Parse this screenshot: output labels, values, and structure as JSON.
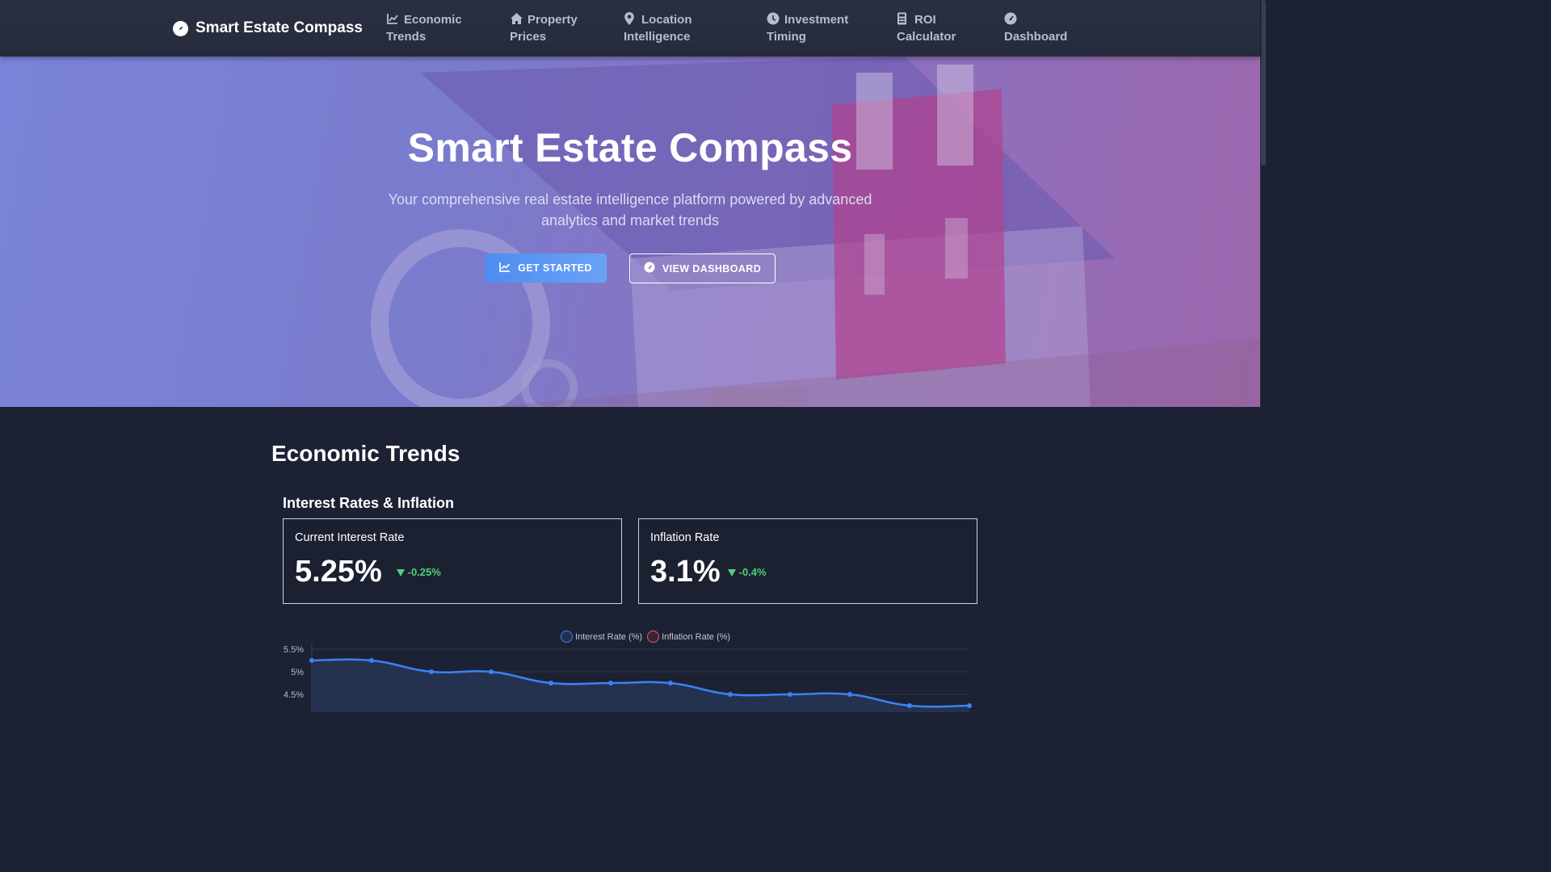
{
  "brand": {
    "name": "Smart Estate Compass",
    "icon": "compass-icon"
  },
  "nav": {
    "items": [
      {
        "line1": "Economic",
        "line2": "Trends",
        "icon": "chart-line-icon"
      },
      {
        "line1": "Property",
        "line2": "Prices",
        "icon": "home-icon"
      },
      {
        "line1": "Location",
        "line2": "Intelligence",
        "icon": "map-pin-icon"
      },
      {
        "line1": "Investment",
        "line2": "Timing",
        "icon": "clock-icon"
      },
      {
        "line1": "ROI",
        "line2": "Calculator",
        "icon": "calculator-icon"
      },
      {
        "line1": "",
        "line2": "Dashboard",
        "icon": "gauge-icon"
      }
    ]
  },
  "hero": {
    "title": "Smart Estate Compass",
    "subtitle": "Your comprehensive real estate intelligence platform powered by advanced analytics and market trends",
    "primary_button": "GET STARTED",
    "secondary_button": "VIEW DASHBOARD"
  },
  "economic": {
    "title": "Economic Trends",
    "subtitle": "Interest Rates & Inflation",
    "cards": [
      {
        "label": "Current Interest Rate",
        "value": "5.25%",
        "change": "-0.25%"
      },
      {
        "label": "Inflation Rate",
        "value": "3.1%",
        "change": "-0.4%"
      }
    ]
  },
  "colors": {
    "accent": "#4e8cf0",
    "positive": "#4fd17a",
    "interest_line": "#3b82f6",
    "inflation_line": "#e35d6a"
  },
  "chart_data": {
    "type": "line",
    "series": [
      {
        "name": "Interest Rate (%)",
        "values": [
          5.25,
          5.25,
          5.0,
          5.0,
          4.75,
          4.75,
          4.75,
          4.5,
          4.5,
          4.5,
          4.25,
          4.25
        ]
      },
      {
        "name": "Inflation Rate (%)",
        "values": []
      }
    ],
    "y_ticks": [
      "5.5%",
      "5%",
      "4.5%"
    ],
    "ylim": [
      4.0,
      5.5
    ],
    "grid": true,
    "legend_position": "top-center"
  }
}
